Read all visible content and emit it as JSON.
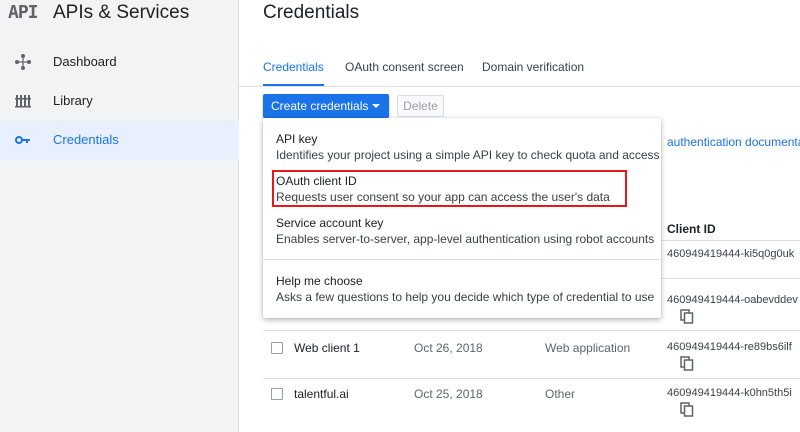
{
  "sidebar": {
    "logo": "API",
    "title": "APIs & Services",
    "items": [
      {
        "label": "Dashboard",
        "icon": "dashboard-icon"
      },
      {
        "label": "Library",
        "icon": "library-icon"
      },
      {
        "label": "Credentials",
        "icon": "key-icon",
        "active": true
      }
    ]
  },
  "main": {
    "title": "Credentials",
    "tabs": [
      {
        "label": "Credentials",
        "active": true
      },
      {
        "label": "OAuth consent screen"
      },
      {
        "label": "Domain verification"
      }
    ],
    "create_button_label": "Create credentials",
    "delete_button_label": "Delete",
    "auth_link_text": "authentication documenta",
    "table": {
      "client_id_header": "Client ID",
      "rows": [
        {
          "name": "",
          "date": "",
          "type": "",
          "client_id": "460949419444-ki5q0g0uk"
        },
        {
          "name": "",
          "date": "",
          "type": "",
          "client_id": "460949419444-oabevddev"
        },
        {
          "name": "Web client 1",
          "date": "Oct 26, 2018",
          "type": "Web application",
          "client_id": "460949419444-re89bs6ilf"
        },
        {
          "name": "talentful.ai",
          "date": "Oct 25, 2018",
          "type": "Other",
          "client_id": "460949419444-k0hn5th5i"
        }
      ]
    }
  },
  "dropdown": {
    "items": [
      {
        "title": "API key",
        "description": "Identifies your project using a simple API key to check quota and access"
      },
      {
        "title": "OAuth client ID",
        "description": "Requests user consent so your app can access the user's data",
        "highlighted": true
      },
      {
        "title": "Service account key",
        "description": "Enables server-to-server, app-level authentication using robot accounts"
      },
      {
        "title": "Help me choose",
        "description": "Asks a few questions to help you decide which type of credential to use"
      }
    ]
  },
  "colors": {
    "accent": "#1a73e8",
    "highlight_box": "#e8171b",
    "sidebar_bg": "#f1f3f4",
    "active_item_bg": "#e8f0fe"
  }
}
